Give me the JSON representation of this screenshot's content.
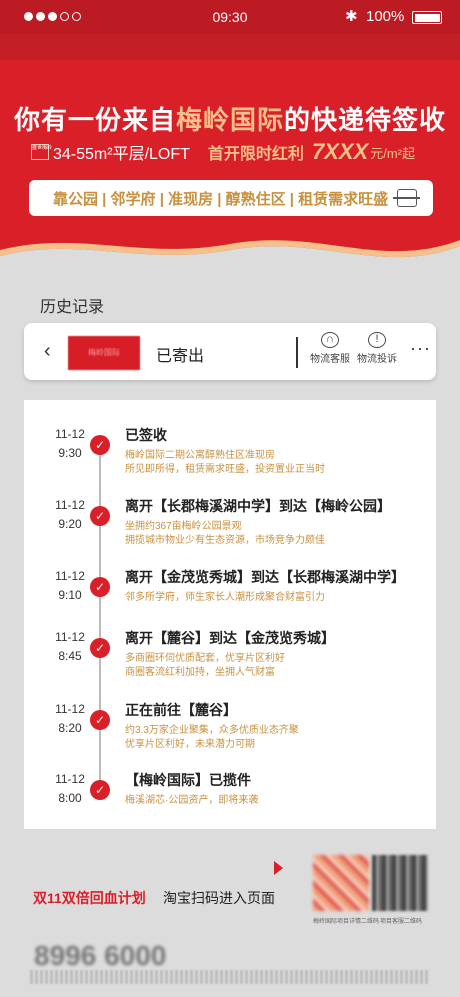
{
  "status": {
    "time": "09:30",
    "battery": "100%",
    "bluetooth": "✱",
    "signal_dots": 5,
    "signal_filled": 3
  },
  "hero": {
    "title_a": "你有一份来自",
    "title_b": "梅岭国际",
    "title_c": "的快递待签收",
    "logo_text": "盛世梅岭",
    "size": "34-55m²平层/LOFT",
    "promo": "首开限时红利",
    "price": "7XXX",
    "unit": "元/m²起"
  },
  "search": {
    "tags": "靠公园 | 邻学府 | 准现房 | 醇熟住区 | 租赁需求旺盛"
  },
  "history_title": "历史记录",
  "tracking": {
    "back": "‹",
    "thumb_text": "梅岭国际",
    "status": "已寄出",
    "service_label": "物流客服",
    "complaint_label": "物流投诉",
    "more": "···"
  },
  "steps": [
    {
      "date": "11-12",
      "time": "9:30",
      "title": "已签收",
      "line1": "梅岭国际二期公寓醇熟住区准现房",
      "line2": "所见即所得，租赁需求旺盛，投资置业正当时"
    },
    {
      "date": "11-12",
      "time": "9:20",
      "title": "离开【长郡梅溪湖中学】到达【梅岭公园】",
      "line1": "坐拥约367亩梅岭公园景观",
      "line2": "拥揽城市物业少有生态资源，市场竞争力颇佳"
    },
    {
      "date": "11-12",
      "time": "9:10",
      "title": "离开【金茂览秀城】到达【长郡梅溪湖中学】",
      "line1": "邻多所学府，师生家长人潮形成聚合财富引力",
      "line2": ""
    },
    {
      "date": "11-12",
      "time": "8:45",
      "title": "离开【麓谷】到达【金茂览秀城】",
      "line1": "多商圈环伺优质配套，优享片区利好",
      "line2": "商圈客流红利加持，坐拥人气财富"
    },
    {
      "date": "11-12",
      "time": "8:20",
      "title": "正在前往【麓谷】",
      "line1": "约3.3万家企业聚集，众多优质业态齐聚",
      "line2": "优享片区利好，未来潜力可期"
    },
    {
      "date": "11-12",
      "time": "8:00",
      "title": "【梅岭国际】已揽件",
      "line1": "梅溪湖芯·公园资产，即将来袭",
      "line2": ""
    }
  ],
  "footer": {
    "campaign": "双11双倍回血计划",
    "scan_text": "淘宝扫码进入页面",
    "qr1_caption": "梅岭国际项目详情二维码",
    "qr2_caption": "项目客服二维码",
    "phone": "8996 6000"
  },
  "colors": {
    "brand_red": "#d91f28",
    "gold": "#f5c089",
    "accent_brown": "#c8913f"
  }
}
